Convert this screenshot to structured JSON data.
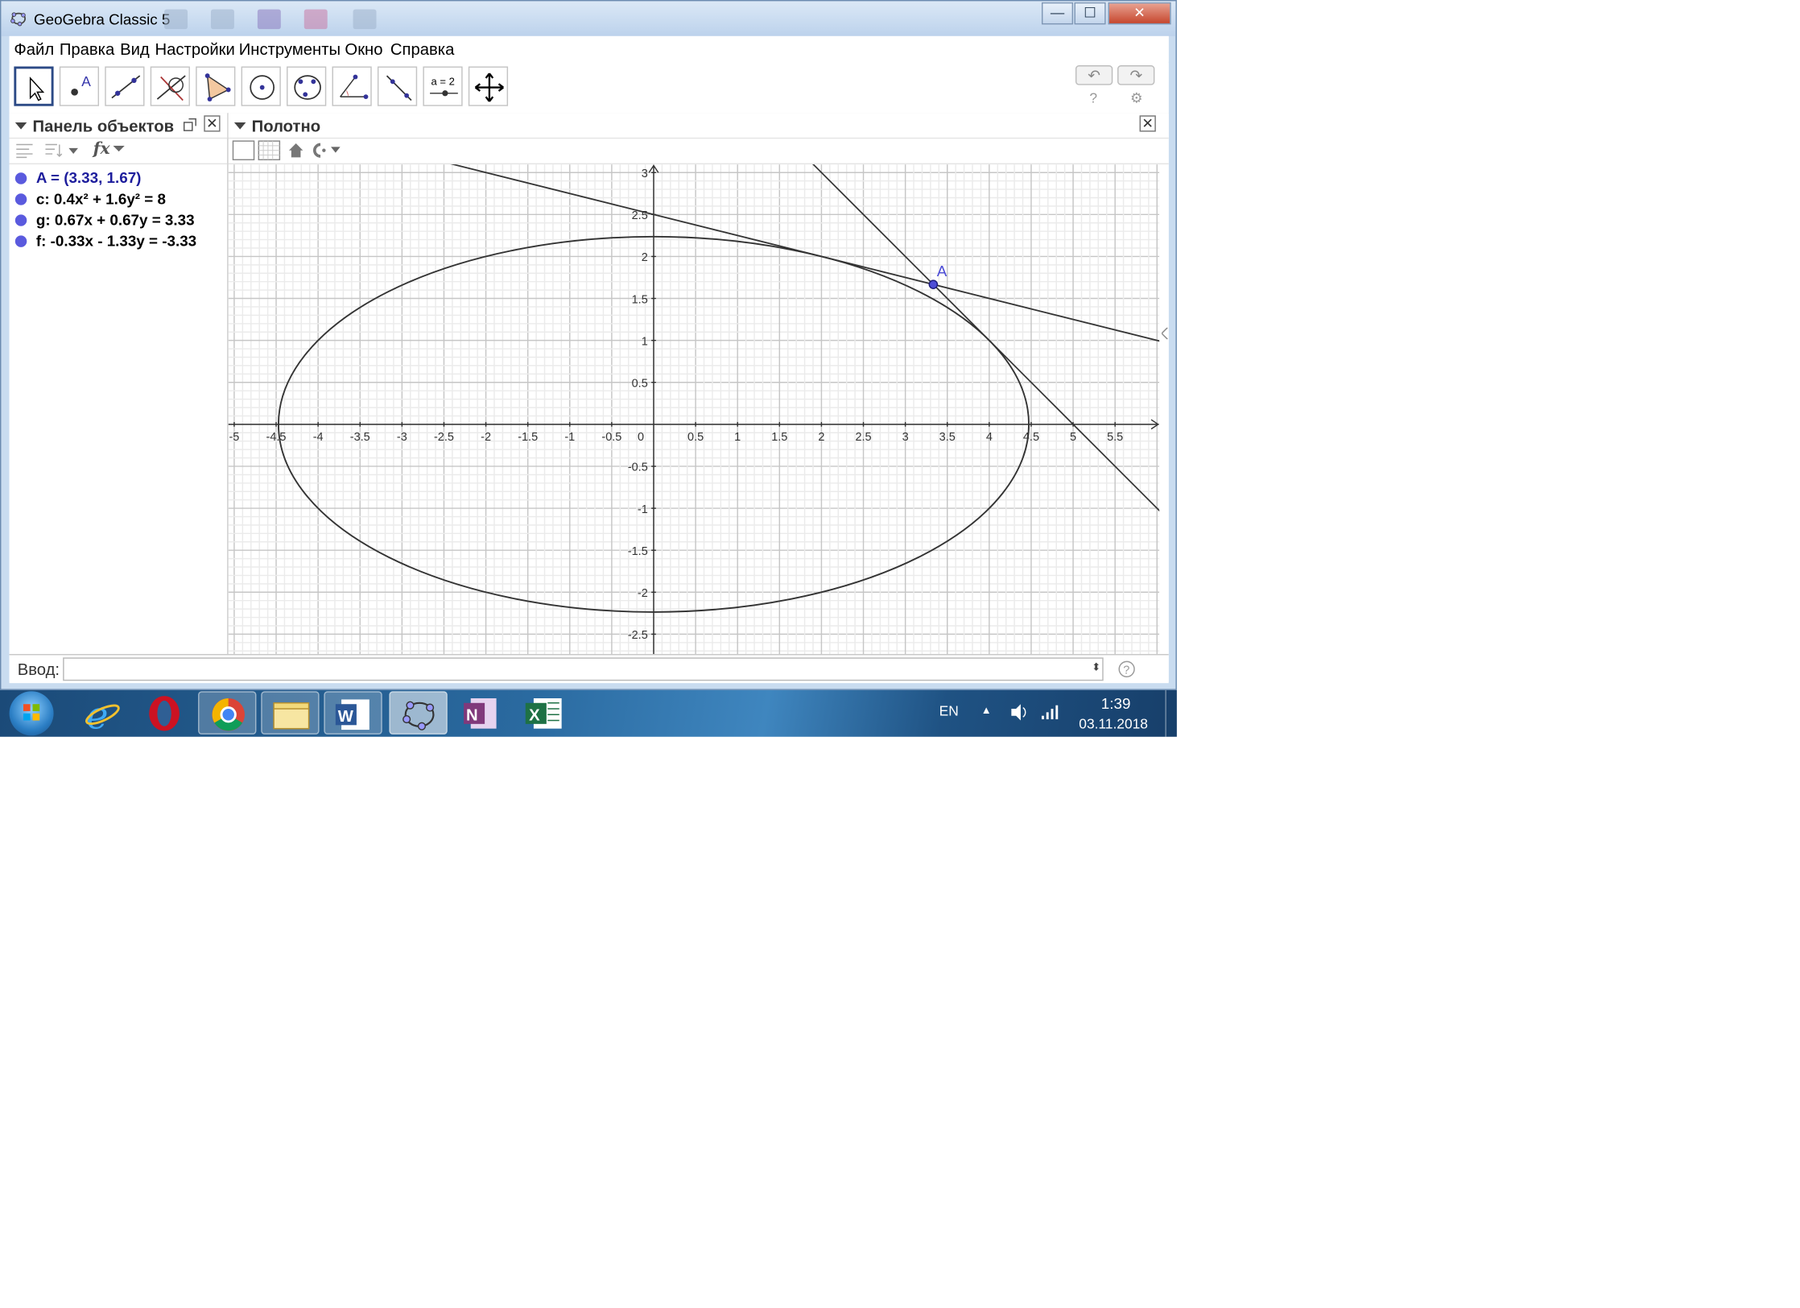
{
  "window": {
    "title": "GeoGebra Classic 5",
    "minimize_glyph": "—",
    "maximize_glyph": "☐",
    "close_glyph": "✕"
  },
  "menu": [
    "Файл",
    "Правка",
    "Вид",
    "Настройки",
    "Инструменты",
    "Окно",
    "Справка"
  ],
  "toolbar": {
    "tools": [
      "move-tool-icon",
      "point-tool-icon",
      "line-tool-icon",
      "perpendicular-tool-icon",
      "polygon-tool-icon",
      "circle-tool-icon",
      "conic-tool-icon",
      "angle-tool-icon",
      "reflect-tool-icon",
      "slider-tool-icon",
      "move-graphics-tool-icon"
    ],
    "slider_tool_text": "a = 2",
    "undo_glyph": "↶",
    "redo_glyph": "↷",
    "help_glyph": "?",
    "settings_glyph": "⚙"
  },
  "algebra": {
    "title": "Панель объектов",
    "fx_label": "fx",
    "objects": [
      {
        "text": "A = (3.33, 1.67)",
        "color": "#1c1c9c"
      },
      {
        "text": "c: 0.4x² + 1.6y² = 8",
        "color": "#000000"
      },
      {
        "text": "g: 0.67x + 0.67y = 3.33",
        "color": "#000000"
      },
      {
        "text": "f: -0.33x - 1.33y = -3.33",
        "color": "#000000"
      }
    ]
  },
  "graphics": {
    "title": "Полотно",
    "point_label": "A",
    "x_ticks": [
      "-5",
      "-4.5",
      "-4",
      "-3.5",
      "-3",
      "-2.5",
      "-2",
      "-1.5",
      "-1",
      "-0.5",
      "0",
      "0.5",
      "1",
      "1.5",
      "2",
      "2.5",
      "3",
      "3.5",
      "4",
      "4.5",
      "5",
      "5.5"
    ],
    "y_ticks": [
      "3",
      "2.5",
      "2",
      "1.5",
      "1",
      "0.5",
      "-0.5",
      "-1",
      "-1.5",
      "-2",
      "-2.5"
    ]
  },
  "input": {
    "label": "Ввод:",
    "value": "",
    "placeholder": ""
  },
  "taskbar": {
    "apps": [
      "ie-icon",
      "opera-icon",
      "chrome-icon",
      "explorer-icon",
      "word-icon",
      "geogebra-icon",
      "onenote-icon",
      "excel-icon"
    ],
    "language": "EN",
    "time": "1:39",
    "date": "03.11.2018"
  }
}
